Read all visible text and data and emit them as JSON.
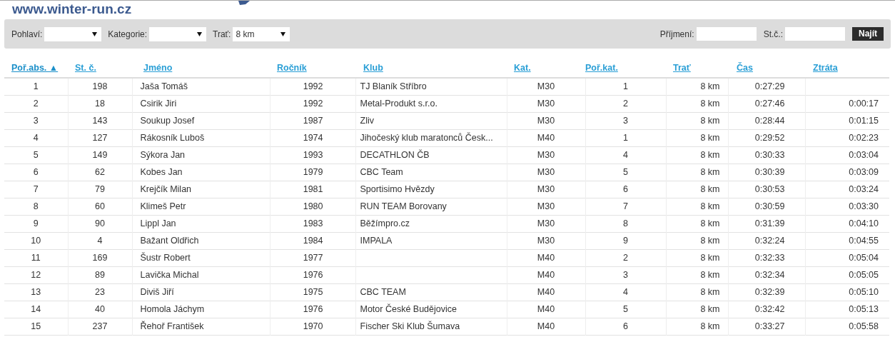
{
  "logo": "www.winter-run.cz",
  "filters": {
    "gender": {
      "label": "Pohlaví:"
    },
    "category": {
      "label": "Kategorie:"
    },
    "course": {
      "label": "Trať:",
      "value": "8 km"
    },
    "surname": {
      "label": "Příjmení:"
    },
    "number": {
      "label": "St.č.:"
    },
    "button": "Najít"
  },
  "table": {
    "columns": [
      {
        "label": "Poř.abs. ▲",
        "selected": true
      },
      {
        "label": "St. č.",
        "selected": false
      },
      {
        "label": "Jméno",
        "selected": false
      },
      {
        "label": "Ročník",
        "selected": false
      },
      {
        "label": "Klub",
        "selected": false
      },
      {
        "label": "Kat.",
        "selected": false
      },
      {
        "label": "Poř.kat.",
        "selected": false
      },
      {
        "label": "Trať",
        "selected": false
      },
      {
        "label": "Čas",
        "selected": false
      },
      {
        "label": "Ztráta",
        "selected": false
      }
    ],
    "rows": [
      [
        "1",
        "198",
        "Jaša Tomáš",
        "1992",
        "TJ Blaník Stříbro",
        "M30",
        "1",
        "8 km",
        "0:27:29",
        null
      ],
      [
        "2",
        "18",
        "Csirik Jiri",
        "1992",
        "Metal-Produkt s.r.o.",
        "M30",
        "2",
        "8 km",
        "0:27:46",
        "0:00:17"
      ],
      [
        "3",
        "143",
        "Soukup Josef",
        "1987",
        "Zliv",
        "M30",
        "3",
        "8 km",
        "0:28:44",
        "0:01:15"
      ],
      [
        "4",
        "127",
        "Rákosník Luboš",
        "1974",
        "Jihočeský klub maratonců Česk...",
        "M40",
        "1",
        "8 km",
        "0:29:52",
        "0:02:23"
      ],
      [
        "5",
        "149",
        "Sýkora Jan",
        "1993",
        "DECATHLON ČB",
        "M30",
        "4",
        "8 km",
        "0:30:33",
        "0:03:04"
      ],
      [
        "6",
        "62",
        "Kobes Jan",
        "1979",
        "CBC Team",
        "M30",
        "5",
        "8 km",
        "0:30:39",
        "0:03:09"
      ],
      [
        "7",
        "79",
        "Krejčík Milan",
        "1981",
        "Sportisimo Hvězdy",
        "M30",
        "6",
        "8 km",
        "0:30:53",
        "0:03:24"
      ],
      [
        "8",
        "60",
        "Klimeš Petr",
        "1980",
        "RUN TEAM Borovany",
        "M30",
        "7",
        "8 km",
        "0:30:59",
        "0:03:30"
      ],
      [
        "9",
        "90",
        "Lippl Jan",
        "1983",
        "Běžímpro.cz",
        "M30",
        "8",
        "8 km",
        "0:31:39",
        "0:04:10"
      ],
      [
        "10",
        "4",
        "Bažant Oldřich",
        "1984",
        "IMPALA",
        "M30",
        "9",
        "8 km",
        "0:32:24",
        "0:04:55"
      ],
      [
        "11",
        "169",
        "Šustr Robert",
        "1977",
        null,
        "M40",
        "2",
        "8 km",
        "0:32:33",
        "0:05:04"
      ],
      [
        "12",
        "89",
        "Lavička Michal",
        "1976",
        null,
        "M40",
        "3",
        "8 km",
        "0:32:34",
        "0:05:05"
      ],
      [
        "13",
        "23",
        "Diviš Jiří",
        "1975",
        "CBC TEAM",
        "M40",
        "4",
        "8 km",
        "0:32:39",
        "0:05:10"
      ],
      [
        "14",
        "40",
        "Homola Jáchym",
        "1976",
        "Motor České Budějovice",
        "M40",
        "5",
        "8 km",
        "0:32:42",
        "0:05:13"
      ],
      [
        "15",
        "237",
        "Řehoř František",
        "1970",
        "Fischer Ski Klub Šumava",
        "M40",
        "6",
        "8 km",
        "0:33:27",
        "0:05:58"
      ]
    ]
  }
}
